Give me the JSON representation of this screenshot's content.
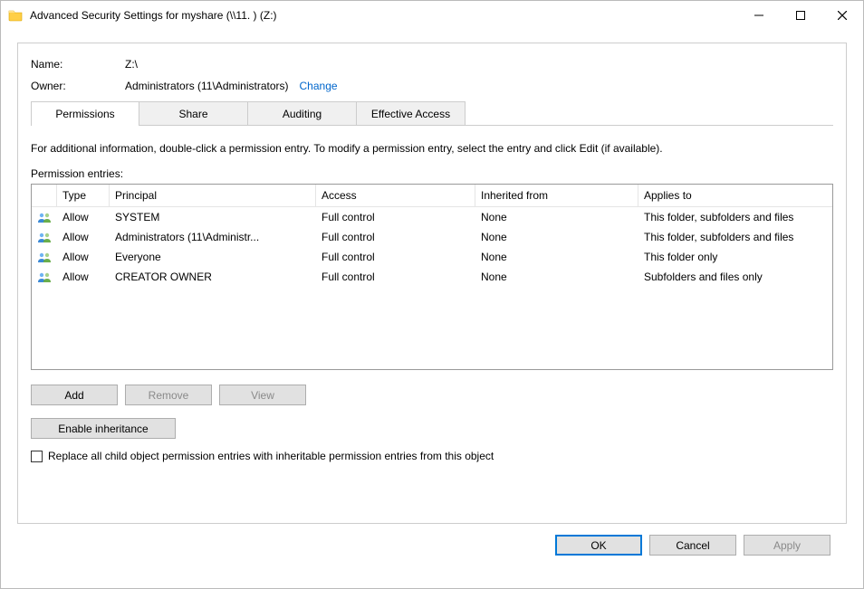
{
  "window": {
    "title": "Advanced Security Settings for myshare (\\\\11.            ) (Z:)"
  },
  "name_row": {
    "label": "Name:",
    "value": "Z:\\"
  },
  "owner_row": {
    "label": "Owner:",
    "value": "Administrators (11\\Administrators)",
    "change_link": "Change"
  },
  "tabs": {
    "0": {
      "label": "Permissions"
    },
    "1": {
      "label": "Share"
    },
    "2": {
      "label": "Auditing"
    },
    "3": {
      "label": "Effective Access"
    }
  },
  "description": "For additional information, double-click a permission entry. To modify a permission entry, select the entry and click Edit (if available).",
  "entries_label": "Permission entries:",
  "columns": {
    "type": "Type",
    "principal": "Principal",
    "access": "Access",
    "inherited": "Inherited from",
    "applies": "Applies to"
  },
  "rows": {
    "0": {
      "type": "Allow",
      "principal": "SYSTEM",
      "access": "Full control",
      "inherited": "None",
      "applies": "This folder, subfolders and files"
    },
    "1": {
      "type": "Allow",
      "principal": "Administrators (11\\Administr...",
      "access": "Full control",
      "inherited": "None",
      "applies": "This folder, subfolders and files"
    },
    "2": {
      "type": "Allow",
      "principal": "Everyone",
      "access": "Full control",
      "inherited": "None",
      "applies": "This folder only"
    },
    "3": {
      "type": "Allow",
      "principal": "CREATOR OWNER",
      "access": "Full control",
      "inherited": "None",
      "applies": "Subfolders and files only"
    }
  },
  "buttons": {
    "add": "Add",
    "remove": "Remove",
    "view": "View",
    "enable_inheritance": "Enable inheritance",
    "ok": "OK",
    "cancel": "Cancel",
    "apply": "Apply"
  },
  "replace_checkbox": {
    "label": "Replace all child object permission entries with inheritable permission entries from this object",
    "checked": false
  }
}
